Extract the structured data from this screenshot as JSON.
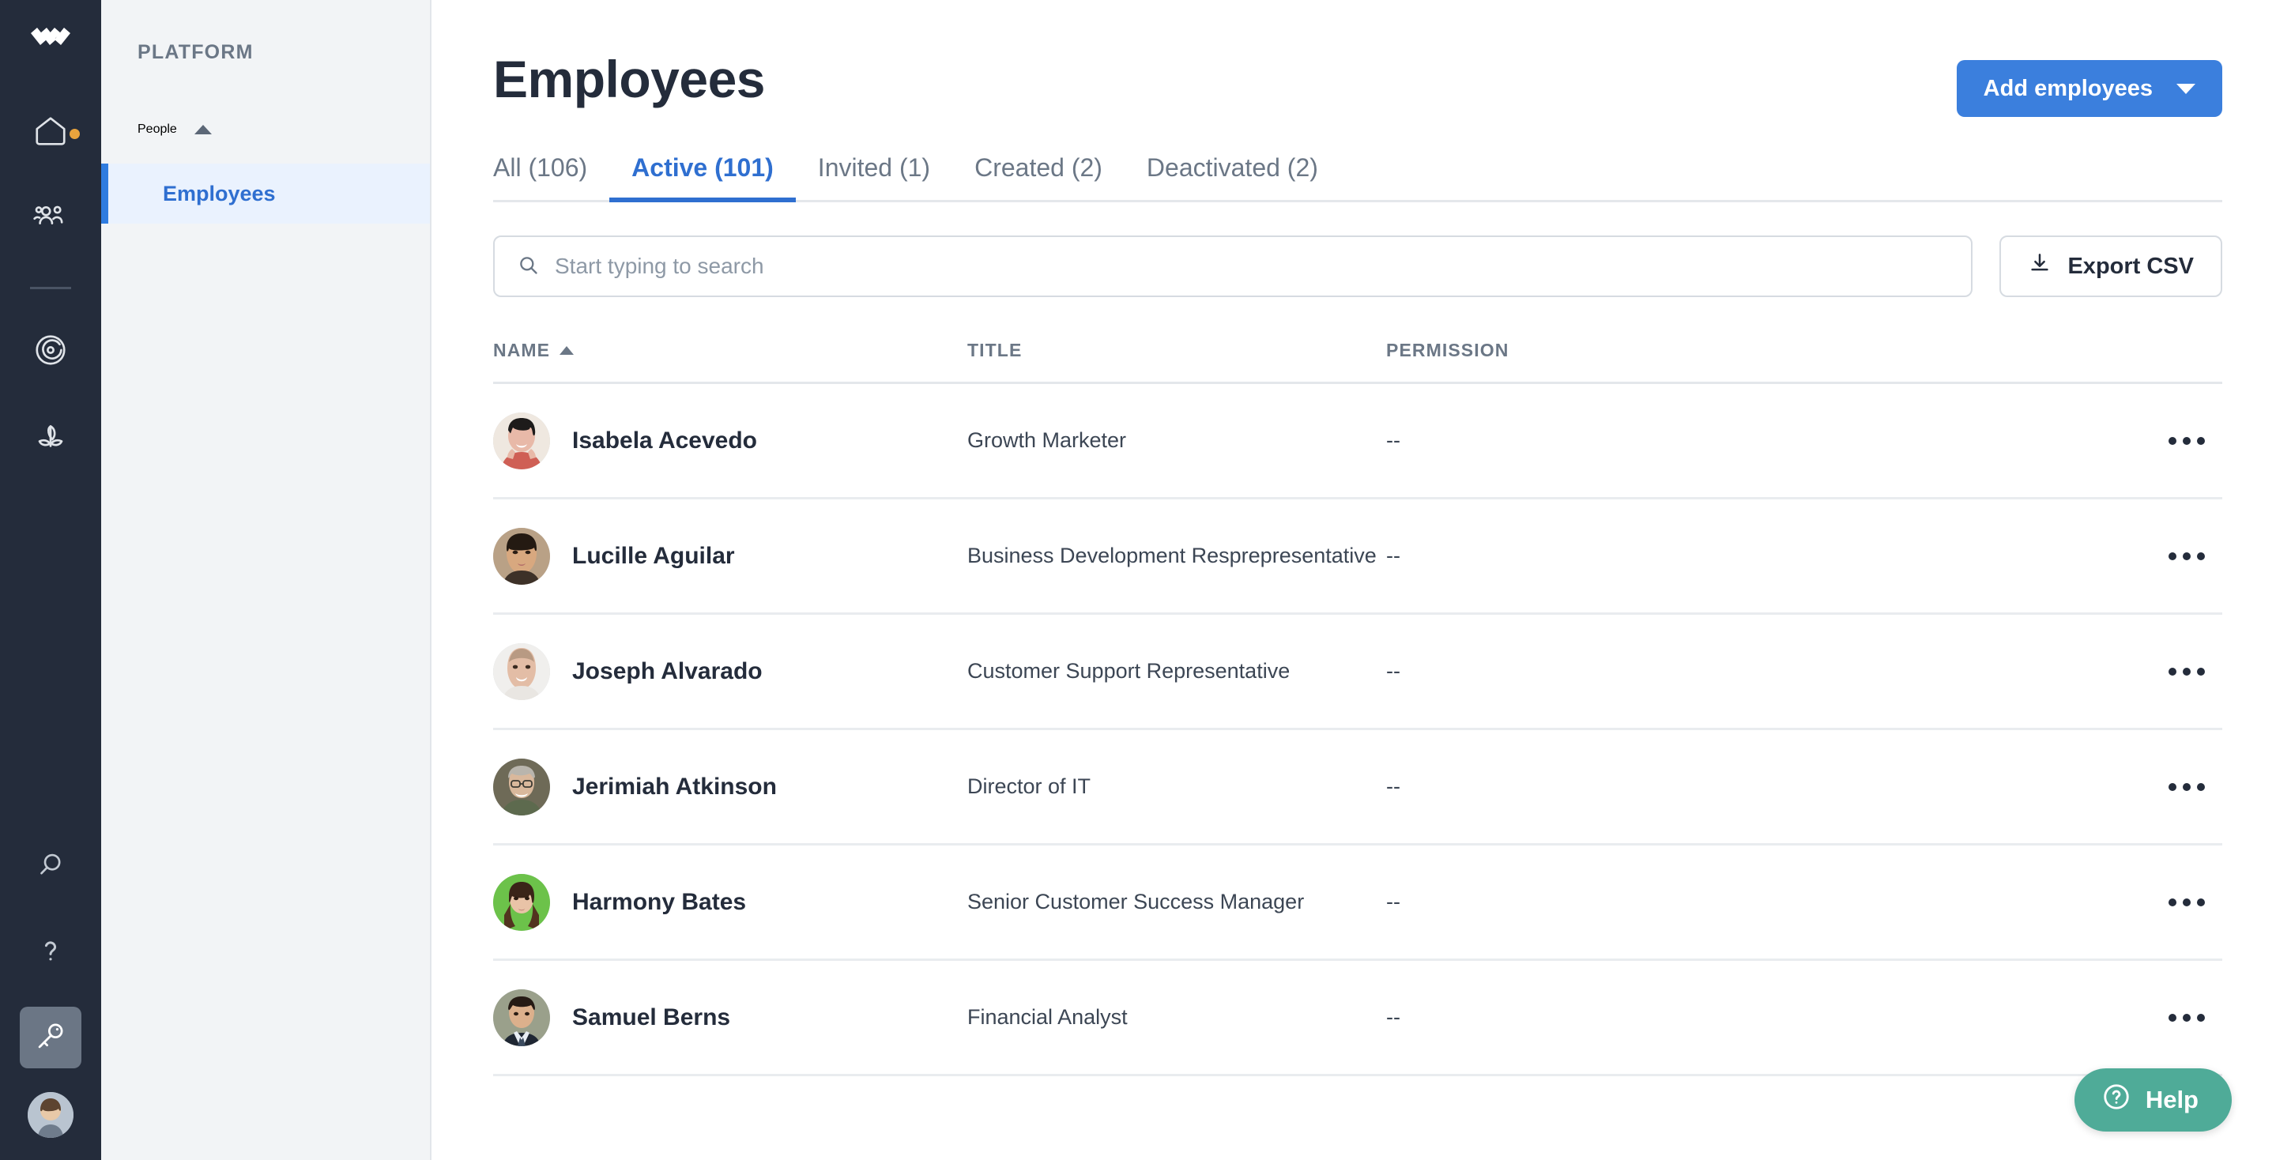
{
  "brand": {
    "logo_icon": "wavy-chevrons-logo"
  },
  "rail": {
    "items": [
      {
        "icon": "home-icon",
        "has_badge": true
      },
      {
        "icon": "people-icon",
        "has_badge": false
      },
      {
        "icon": "target-icon",
        "has_badge": false
      },
      {
        "icon": "plant-growth-icon",
        "has_badge": false
      }
    ],
    "bottom_items": [
      {
        "icon": "search-icon",
        "active": false
      },
      {
        "icon": "question-mark-icon",
        "active": false
      },
      {
        "icon": "key-icon",
        "active": true
      }
    ],
    "avatar": "user-avatar"
  },
  "sidebar": {
    "section_label": "PLATFORM",
    "group": {
      "label": "People",
      "expanded": true,
      "caret_icon": "caret-up-icon"
    },
    "items": [
      {
        "label": "Employees",
        "selected": true
      }
    ]
  },
  "header": {
    "title": "Employees",
    "primary_button": {
      "label": "Add employees",
      "caret_icon": "caret-down-icon",
      "color": "#3b7fdd"
    }
  },
  "tabs": [
    {
      "label": "All (106)",
      "active": false
    },
    {
      "label": "Active (101)",
      "active": true
    },
    {
      "label": "Invited (1)",
      "active": false
    },
    {
      "label": "Created (2)",
      "active": false
    },
    {
      "label": "Deactivated (2)",
      "active": false
    }
  ],
  "toolbar": {
    "search": {
      "placeholder": "Start typing to search",
      "value": "",
      "icon": "search-icon"
    },
    "export_button": {
      "label": "Export CSV",
      "icon": "download-icon"
    }
  },
  "table": {
    "columns": [
      {
        "key": "name",
        "label": "NAME",
        "sorted": "asc"
      },
      {
        "key": "title",
        "label": "TITLE",
        "sorted": null
      },
      {
        "key": "permission",
        "label": "PERMISSION",
        "sorted": null
      }
    ],
    "rows": [
      {
        "name": "Isabela Acevedo",
        "title": "Growth Marketer",
        "permission": "--",
        "avatar_tone": "#e8b9a8"
      },
      {
        "name": "Lucille Aguilar",
        "title": "Business Development Resprepresentative",
        "permission": "--",
        "avatar_tone": "#d8a87f"
      },
      {
        "name": "Joseph Alvarado",
        "title": "Customer Support Representative",
        "permission": "--",
        "avatar_tone": "#e3bda6"
      },
      {
        "name": "Jerimiah Atkinson",
        "title": "Director of IT",
        "permission": "--",
        "avatar_tone": "#8d8878"
      },
      {
        "name": "Harmony Bates",
        "title": "Senior Customer Success Manager",
        "permission": "--",
        "avatar_tone": "#6cc24a"
      },
      {
        "name": "Samuel Berns",
        "title": "Financial Analyst",
        "permission": "--",
        "avatar_tone": "#55606b"
      }
    ]
  },
  "help": {
    "label": "Help",
    "icon": "question-circle-icon",
    "color": "#4fab98"
  }
}
